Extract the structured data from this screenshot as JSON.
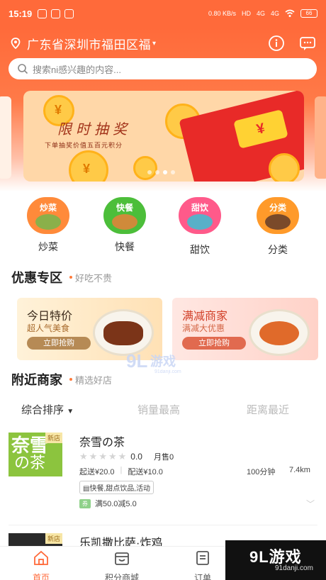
{
  "status_bar": {
    "time": "15:19",
    "net_speed": "0.80 KB/s",
    "hd": "HD",
    "signal_1": "4G",
    "signal_2": "4G",
    "battery": "66"
  },
  "header": {
    "location": "广东省深圳市福田区福",
    "icons": [
      "info-icon",
      "message-icon"
    ]
  },
  "search": {
    "placeholder": "搜索ni感兴趣的内容..."
  },
  "banner": {
    "title": "限时抽奖",
    "subtitle": "下单抽奖价值五百元积分",
    "dots_total": 4,
    "dots_active_index": 2,
    "colors": {
      "bg": "#ffd7a8",
      "envelope": "#e82a28",
      "coin": "#ffca47"
    }
  },
  "categories": [
    {
      "tag": "炒菜",
      "label": "炒菜",
      "color": "#ff8a3a",
      "food_color": "#8ab04a"
    },
    {
      "tag": "快餐",
      "label": "快餐",
      "color": "#4cbe3a",
      "food_color": "#d08a3a"
    },
    {
      "tag": "甜饮",
      "label": "甜饮",
      "color": "#ff5a8a",
      "food_color": "#58b0c8"
    },
    {
      "tag": "分类",
      "label": "分类",
      "color": "#ff9a2a",
      "food_color": "#7a4a2a"
    }
  ],
  "deals": {
    "title": "优惠专区",
    "subtitle": "好吃不贵",
    "promos": [
      {
        "title": "今日特价",
        "subtitle": "超人气美食",
        "button": "立即抢购"
      },
      {
        "title": "满减商家",
        "subtitle": "满减大优惠",
        "button": "立即抢购"
      }
    ]
  },
  "watermark_center": {
    "text": "游戏",
    "small": "91danji.com"
  },
  "nearby": {
    "title": "附近商家",
    "subtitle": "精选好店",
    "sort_tabs": [
      "综合排序",
      "销量最高",
      "距离最近"
    ]
  },
  "shops": [
    {
      "name": "奈雪の茶",
      "logo_line1": "奈雪",
      "logo_line2": "の茶",
      "new_tag": "新店",
      "score": "0.0",
      "sales": "月售0",
      "min_order": "起送¥20.0",
      "delivery_fee": "配送¥10.0",
      "time": "100分钟",
      "distance": "7.4km",
      "category_tag": "快餐,甜点饮品,活动",
      "discount_badge": "券",
      "discount": "满50.0减5.0"
    },
    {
      "name": "乐凯撒比萨·炸鸡",
      "new_tag": "新店"
    }
  ],
  "bottom_nav": [
    {
      "label": "首页",
      "icon": "home-icon",
      "active": true
    },
    {
      "label": "积分商城",
      "icon": "shop-icon",
      "active": false
    },
    {
      "label": "订单",
      "icon": "order-icon",
      "active": false
    }
  ],
  "corner_watermark": {
    "big": "9L游戏",
    "small": "91danji.com"
  }
}
